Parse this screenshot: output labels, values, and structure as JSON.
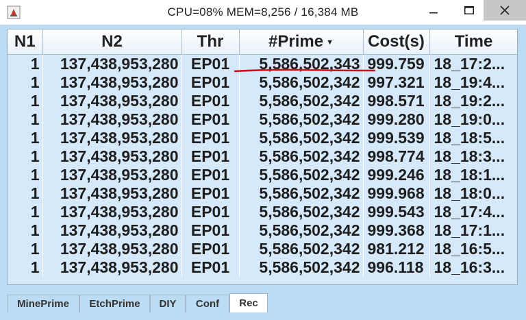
{
  "window": {
    "title": "CPU=08%   MEM=8,256 / 16,384 MB",
    "icon": "java-app-icon",
    "controls": [
      "minimize-icon",
      "maximize-icon",
      "close-icon"
    ]
  },
  "table": {
    "columns": [
      "N1",
      "N2",
      "Thr",
      "#Prime",
      "Cost(s)",
      "Time"
    ],
    "sort_column": "#Prime",
    "sort_direction": "descending",
    "rows": [
      [
        "1",
        "137,438,953,280",
        "EP01",
        "5,586,502,343",
        "999.759",
        "18_17:2..."
      ],
      [
        "1",
        "137,438,953,280",
        "EP01",
        "5,586,502,342",
        "997.321",
        "18_19:4..."
      ],
      [
        "1",
        "137,438,953,280",
        "EP01",
        "5,586,502,342",
        "998.571",
        "18_19:2..."
      ],
      [
        "1",
        "137,438,953,280",
        "EP01",
        "5,586,502,342",
        "999.280",
        "18_19:0..."
      ],
      [
        "1",
        "137,438,953,280",
        "EP01",
        "5,586,502,342",
        "999.539",
        "18_18:5..."
      ],
      [
        "1",
        "137,438,953,280",
        "EP01",
        "5,586,502,342",
        "998.774",
        "18_18:3..."
      ],
      [
        "1",
        "137,438,953,280",
        "EP01",
        "5,586,502,342",
        "999.246",
        "18_18:1..."
      ],
      [
        "1",
        "137,438,953,280",
        "EP01",
        "5,586,502,342",
        "999.968",
        "18_18:0..."
      ],
      [
        "1",
        "137,438,953,280",
        "EP01",
        "5,586,502,342",
        "999.543",
        "18_17:4..."
      ],
      [
        "1",
        "137,438,953,280",
        "EP01",
        "5,586,502,342",
        "999.368",
        "18_17:1..."
      ],
      [
        "1",
        "137,438,953,280",
        "EP01",
        "5,586,502,342",
        "981.212",
        "18_16:5..."
      ],
      [
        "1",
        "137,438,953,280",
        "EP01",
        "5,586,502,342",
        "996.118",
        "18_16:3..."
      ]
    ]
  },
  "tabs": [
    {
      "label": "MinePrime",
      "active": false
    },
    {
      "label": "EtchPrime",
      "active": false
    },
    {
      "label": "DIY",
      "active": false
    },
    {
      "label": "Conf",
      "active": false
    },
    {
      "label": "Rec",
      "active": true
    }
  ],
  "colors": {
    "frame": "#bcdcf3",
    "table_background": "#d6e9fb",
    "annotation_underline": "#d01010"
  }
}
